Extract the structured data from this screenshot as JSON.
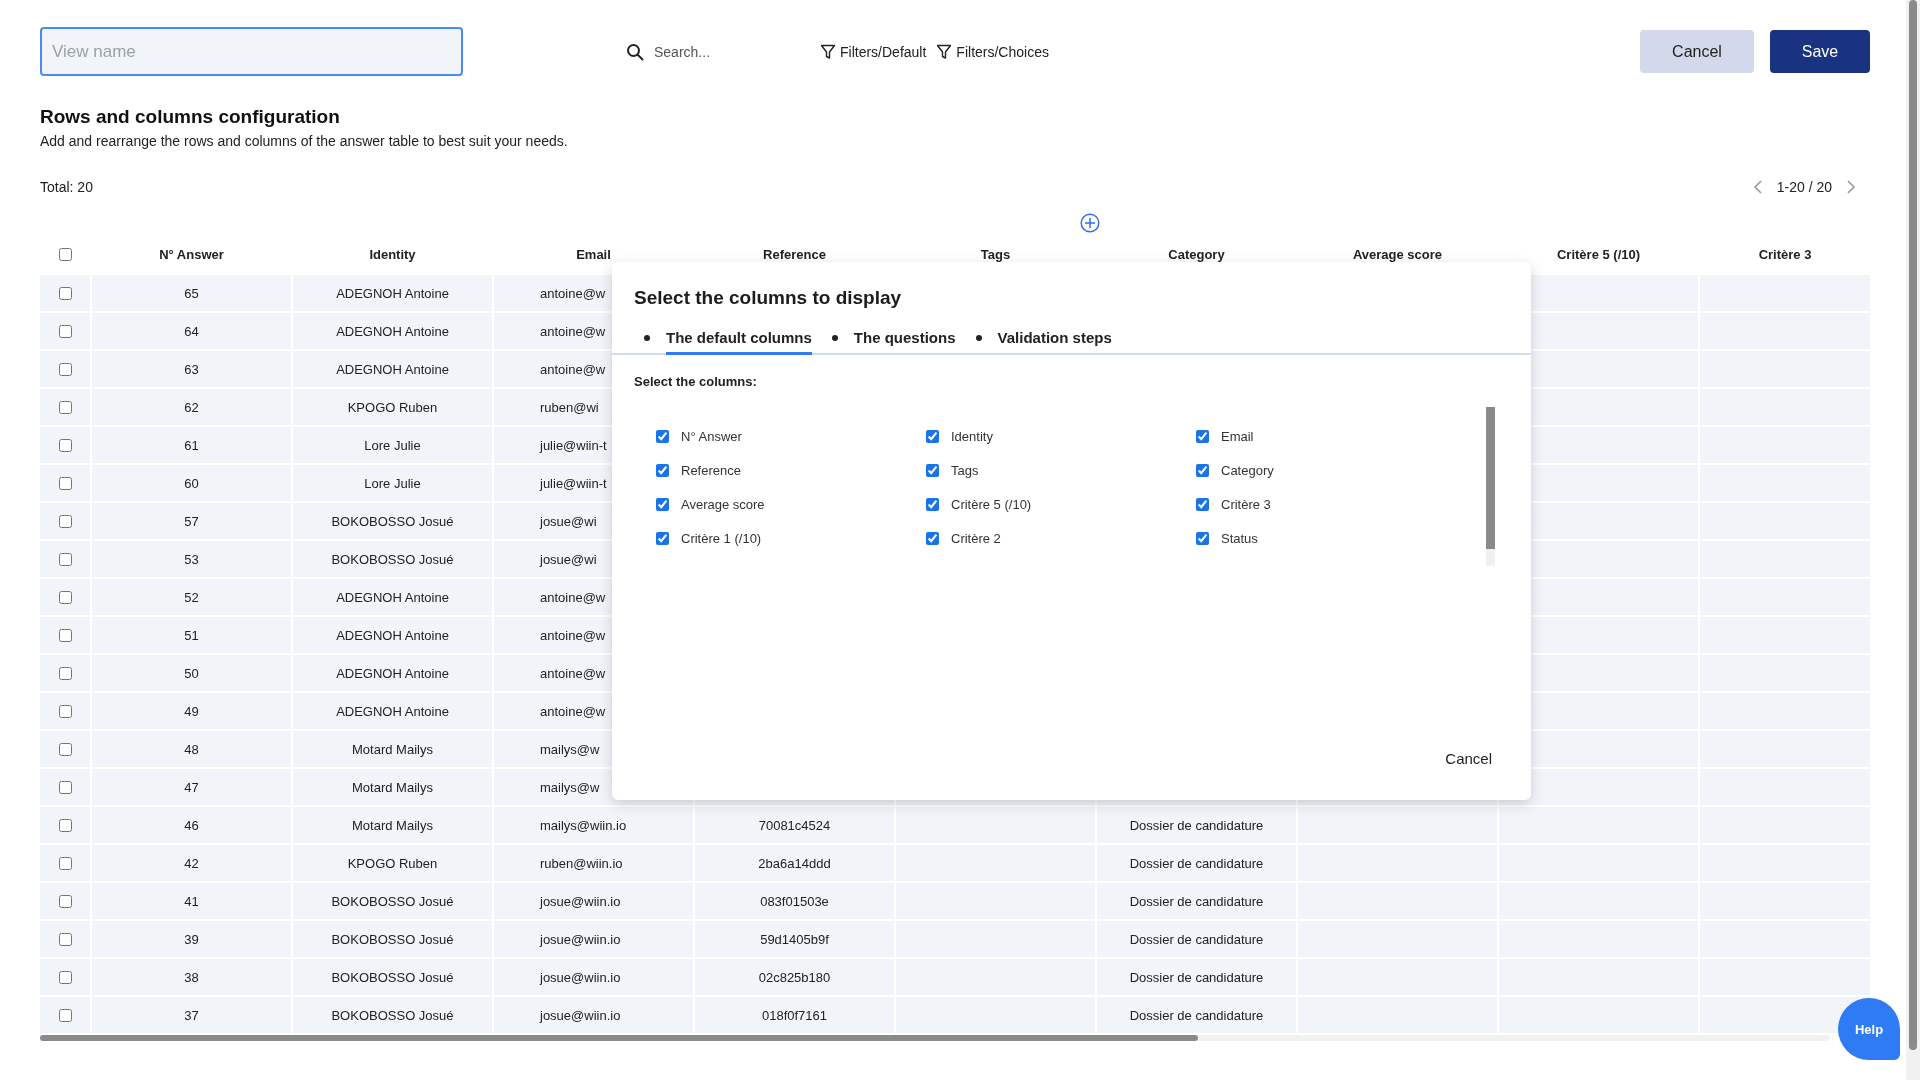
{
  "toolbar": {
    "view_name": {
      "placeholder": "View name"
    },
    "search": {
      "placeholder": "Search..."
    },
    "filters": [
      "Filters/Default",
      "Filters/Choices"
    ],
    "buttons": [
      {
        "label": "Cancel",
        "kind": "secondary"
      },
      {
        "label": "Save",
        "kind": "primary"
      }
    ]
  },
  "config": {
    "title": "Rows and columns configuration",
    "description": "Add and rearrange the rows and columns of the answer table to best suit your needs."
  },
  "total": "Total: 20",
  "pagination": {
    "range": "1-20 / 20"
  },
  "table": {
    "select_all_checked": false,
    "columns": [
      "N° Answer",
      "Identity",
      "Email",
      "Reference",
      "Tags",
      "Category",
      "Average score",
      "Critère 5 (/10)",
      "Critère 3"
    ],
    "rows": [
      {
        "number": "65",
        "identity": "ADEGNOH Antoine",
        "email": "antoine@w",
        "checked": false
      },
      {
        "number": "64",
        "identity": "ADEGNOH Antoine",
        "email": "antoine@w",
        "checked": false
      },
      {
        "number": "63",
        "identity": "ADEGNOH Antoine",
        "email": "antoine@w",
        "checked": false
      },
      {
        "number": "62",
        "identity": "KPOGO Ruben",
        "email": "ruben@wi",
        "checked": false
      },
      {
        "number": "61",
        "identity": "Lore Julie",
        "email": "julie@wiin-t",
        "checked": false
      },
      {
        "number": "60",
        "identity": "Lore Julie",
        "email": "julie@wiin-t",
        "checked": false
      },
      {
        "number": "57",
        "identity": "BOKOBOSSO Josué",
        "email": "josue@wi",
        "checked": false
      },
      {
        "number": "53",
        "identity": "BOKOBOSSO Josué",
        "email": "josue@wi",
        "checked": false
      },
      {
        "number": "52",
        "identity": "ADEGNOH Antoine",
        "email": "antoine@w",
        "checked": false
      },
      {
        "number": "51",
        "identity": "ADEGNOH Antoine",
        "email": "antoine@w",
        "checked": false
      },
      {
        "number": "50",
        "identity": "ADEGNOH Antoine",
        "email": "antoine@w",
        "checked": false
      },
      {
        "number": "49",
        "identity": "ADEGNOH Antoine",
        "email": "antoine@w",
        "checked": false
      },
      {
        "number": "48",
        "identity": "Motard Mailys",
        "email": "mailys@w",
        "checked": false
      },
      {
        "number": "47",
        "identity": "Motard Mailys",
        "email": "mailys@w",
        "checked": false
      },
      {
        "number": "46",
        "identity": "Motard Mailys",
        "email": "mailys@wiin.io",
        "reference": "70081c4524",
        "category": "Dossier de candidature",
        "checked": false
      },
      {
        "number": "42",
        "identity": "KPOGO Ruben",
        "email": "ruben@wiin.io",
        "reference": "2ba6a14ddd",
        "category": "Dossier de candidature",
        "checked": false
      },
      {
        "number": "41",
        "identity": "BOKOBOSSO Josué",
        "email": "josue@wiin.io",
        "reference": "083f01503e",
        "category": "Dossier de candidature",
        "checked": false
      },
      {
        "number": "39",
        "identity": "BOKOBOSSO Josué",
        "email": "josue@wiin.io",
        "reference": "59d1405b9f",
        "category": "Dossier de candidature",
        "checked": false
      },
      {
        "number": "38",
        "identity": "BOKOBOSSO Josué",
        "email": "josue@wiin.io",
        "reference": "02c825b180",
        "category": "Dossier de candidature",
        "checked": false
      },
      {
        "number": "37",
        "identity": "BOKOBOSSO Josué",
        "email": "josue@wiin.io",
        "reference": "018f0f7161",
        "category": "Dossier de candidature",
        "checked": false
      }
    ]
  },
  "modal": {
    "title": "Select the columns to display",
    "tabs": [
      {
        "label": "The default columns",
        "selected": true
      },
      {
        "label": "The questions",
        "selected": false
      },
      {
        "label": "Validation steps",
        "selected": false
      }
    ],
    "section_label": "Select the columns:",
    "options": [
      {
        "label": "N° Answer",
        "checked": true
      },
      {
        "label": "Identity",
        "checked": true
      },
      {
        "label": "Email",
        "checked": true
      },
      {
        "label": "Reference",
        "checked": true
      },
      {
        "label": "Tags",
        "checked": true
      },
      {
        "label": "Category",
        "checked": true
      },
      {
        "label": "Average score",
        "checked": true
      },
      {
        "label": "Critère 5 (/10)",
        "checked": true
      },
      {
        "label": "Critère 3",
        "checked": true
      },
      {
        "label": "Critère 1 (/10)",
        "checked": true
      },
      {
        "label": "Critère 2",
        "checked": true
      },
      {
        "label": "Status",
        "checked": true
      }
    ],
    "cancel": "Cancel"
  },
  "help": "Help"
}
